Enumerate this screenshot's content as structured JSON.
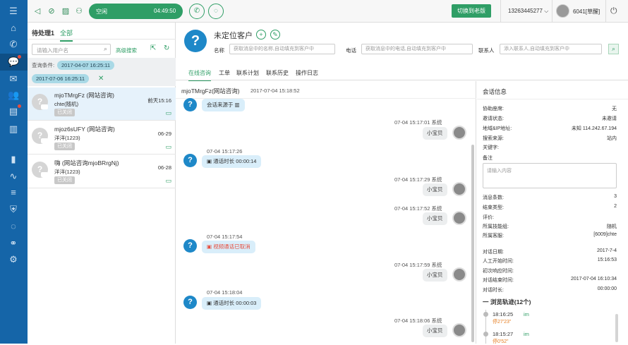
{
  "topbar": {
    "status": "空闲",
    "timer": "04:49:50",
    "switch_label": "切换到老版",
    "phone": "13263445277",
    "user": "6041[草醒]"
  },
  "left": {
    "tab_pending": "待处理1",
    "tab_all": "全部",
    "search_placeholder": "请输入用户名",
    "advanced": "高级搜索",
    "filter_label": "查询条件:",
    "date_start": "2017-04-07 16:25:11",
    "date_end": "2017-07-06 16:25:11",
    "conversations": [
      {
        "name": "mjoTMrgFz (网站咨询)",
        "sub": "chte(随机)",
        "badge": "已关闭",
        "time": "前天15:16"
      },
      {
        "name": "mjoz6sUFY (网站咨询)",
        "sub": "洋洋(1223)",
        "badge": "已关闭",
        "time": "06-29"
      },
      {
        "name": "嗨 (网站咨询mjoBRrgNj)",
        "sub": "洋洋(1223)",
        "badge": "已关闭",
        "time": "06-28"
      }
    ]
  },
  "header": {
    "title": "未定位客户",
    "name_label": "名称",
    "name_ph": "获取消息中的名称,自动填充到客户中",
    "phone_label": "电话",
    "phone_ph": "获取消息中的电话,自动填充到客户中",
    "contact_label": "联系人",
    "contact_ph": "添入联系人,自动填充到客户中"
  },
  "tabs": [
    "在线咨询",
    "工单",
    "联系计划",
    "联系历史",
    "操作日志"
  ],
  "chat": {
    "name": "mjoTMrgFz(网站咨询)",
    "time": "2017-07-04 15:18:52",
    "source_msg": "会话来源于",
    "sys1": "07-04 15:17:01 系统",
    "sys2": "07-04 15:17:29 系统",
    "sys3": "07-04 15:17:52 系统",
    "sys4": "07-04 15:17:59 系统",
    "sys5": "07-04 15:18:06 系统",
    "xiaobao": "小宝贝",
    "t1": "07-04 15:17:26",
    "m1": "通话时长 00:00:14",
    "t2": "07-04 15:17:54",
    "m2": "视频通话已取消",
    "t3": "07-04 15:18:04",
    "m3": "通话时长 00:00:03"
  },
  "info": {
    "title": "会话信息",
    "rows_a": [
      {
        "k": "协助座席:",
        "v": "无"
      },
      {
        "k": "邀请状态:",
        "v": "未邀请"
      },
      {
        "k": "地域&IP地址:",
        "v": "未知 114.242.67.194"
      },
      {
        "k": "搜索来源:",
        "v": "站内"
      },
      {
        "k": "关键字:",
        "v": ""
      }
    ],
    "note_label": "备注",
    "note_ph": "请输入内容",
    "rows_b": [
      {
        "k": "消息条数:",
        "v": "3"
      },
      {
        "k": "结束类型:",
        "v": "2"
      },
      {
        "k": "评价:",
        "v": ""
      },
      {
        "k": "所属技能组:",
        "v": "随机"
      },
      {
        "k": "所属客服:",
        "v": "[6009]chte"
      }
    ],
    "rows_c": [
      {
        "k": "对话日期:",
        "v": "2017-7-4"
      },
      {
        "k": "人工开始时间:",
        "v": "15:16:53"
      },
      {
        "k": "初次响应时间:",
        "v": ""
      },
      {
        "k": "对话结束时间:",
        "v": "2017-07-04 16:10:34"
      },
      {
        "k": "对话时长:",
        "v": "00:00:00"
      }
    ],
    "traj_title": "一 浏览轨迹(12个)",
    "traj": [
      {
        "time": "18:16:25",
        "src": "im",
        "dur": "停27'23\""
      },
      {
        "time": "18:15:27",
        "src": "im",
        "dur": "停0'52\""
      }
    ]
  }
}
